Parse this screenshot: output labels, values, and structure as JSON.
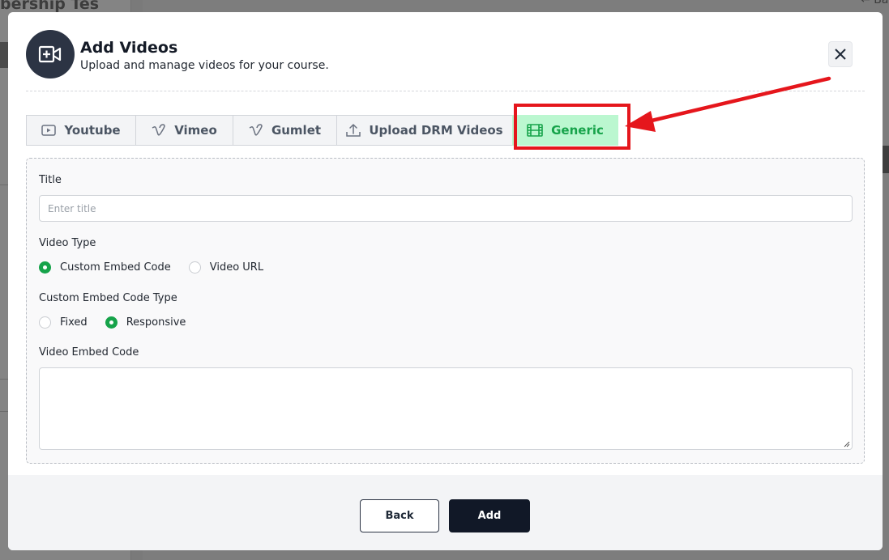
{
  "background": {
    "title_fragment": "bership Tes",
    "back_fragment": "Ba"
  },
  "modal": {
    "icon": "video-plus-icon",
    "title": "Add Videos",
    "subtitle": "Upload and manage videos for your course.",
    "close_icon": "close-icon"
  },
  "tabs": [
    {
      "label": "Youtube",
      "icon": "youtube-icon",
      "active": false
    },
    {
      "label": "Vimeo",
      "icon": "vimeo-icon",
      "active": false
    },
    {
      "label": "Gumlet",
      "icon": "gumlet-icon",
      "active": false
    },
    {
      "label": "Upload DRM Videos",
      "icon": "upload-icon",
      "active": false
    },
    {
      "label": "Generic",
      "icon": "film-icon",
      "active": true
    }
  ],
  "form": {
    "title_label": "Title",
    "title_placeholder": "Enter title",
    "title_value": "",
    "video_type_label": "Video Type",
    "video_type_options": [
      {
        "label": "Custom Embed Code",
        "checked": true
      },
      {
        "label": "Video URL",
        "checked": false
      }
    ],
    "embed_type_label": "Custom Embed Code Type",
    "embed_type_options": [
      {
        "label": "Fixed",
        "checked": false
      },
      {
        "label": "Responsive",
        "checked": true
      }
    ],
    "embed_code_label": "Video Embed Code",
    "embed_code_value": ""
  },
  "footer": {
    "back_label": "Back",
    "add_label": "Add"
  },
  "colors": {
    "accent_green": "#16a34a",
    "active_tab_bg": "#bbf7d0",
    "dark": "#111827",
    "annotation_red": "#e5161c"
  }
}
